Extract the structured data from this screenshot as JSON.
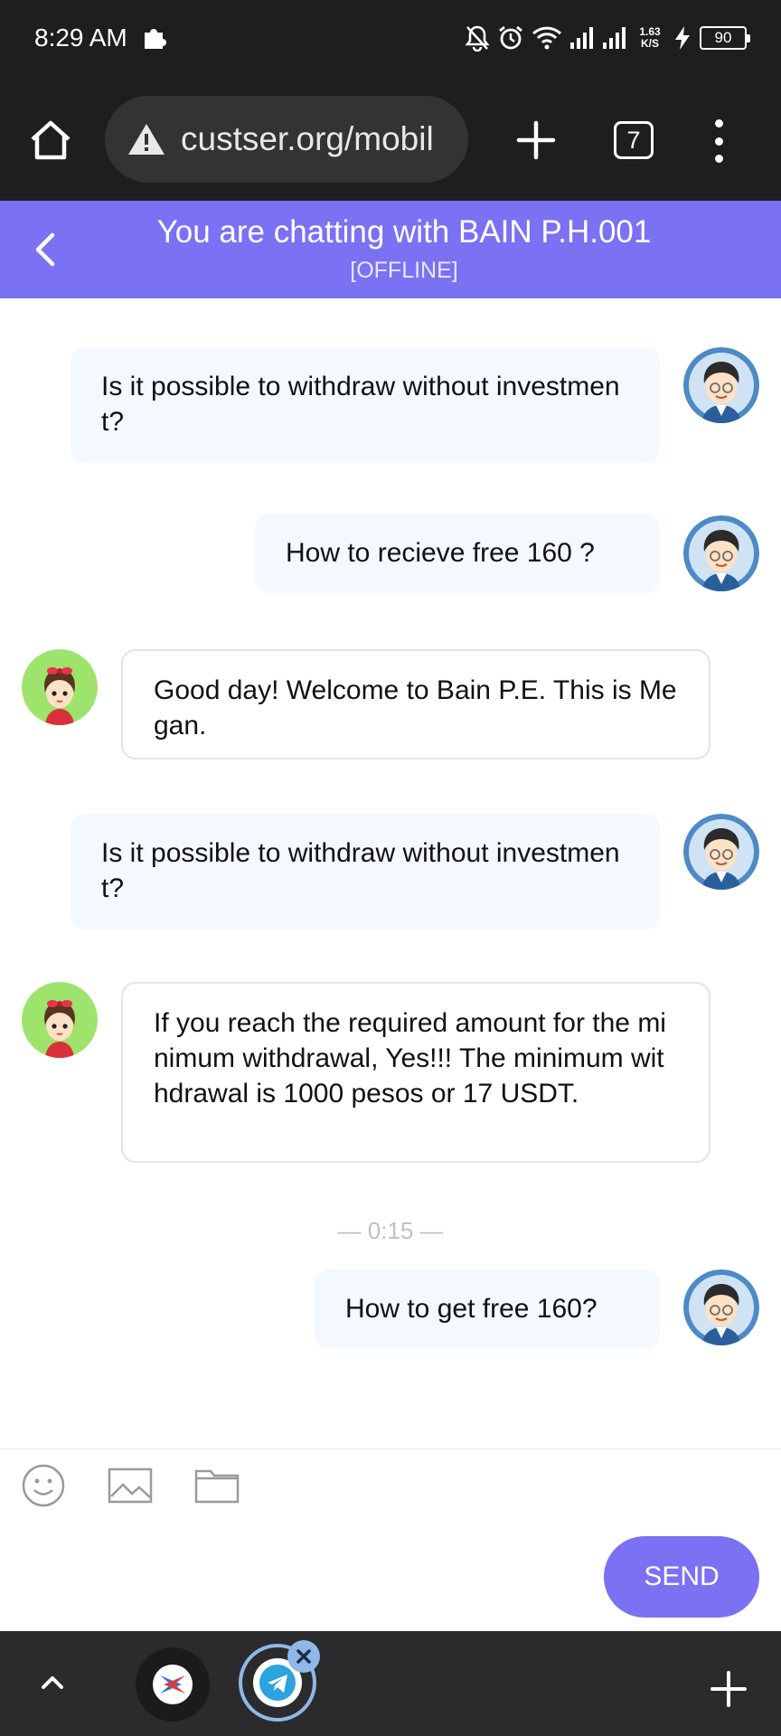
{
  "status_bar": {
    "time": "8:29 AM",
    "speed_value": "1.63",
    "speed_unit": "K/S",
    "battery": "90",
    "icons": [
      "puzzle-icon",
      "mute-icon",
      "alarm-icon",
      "wifi-icon",
      "signal-icon",
      "signal-icon",
      "charging-icon",
      "battery-icon"
    ]
  },
  "browser": {
    "url": "custser.org/mobil",
    "tab_count": "7",
    "icons": [
      "home-icon",
      "warning-icon",
      "plus-icon",
      "tabs-icon",
      "more-icon"
    ]
  },
  "chat": {
    "title": "You are chatting with BAIN P.H.001",
    "status": "[OFFLINE]",
    "accent_color": "#7b71f3",
    "messages": [
      {
        "side": "out",
        "text": "Is it possible to withdraw without investment?"
      },
      {
        "side": "out",
        "text": "How to recieve free 160 ?"
      },
      {
        "side": "in",
        "text": "Good day! Welcome to Bain P.E. This is Megan."
      },
      {
        "side": "out",
        "text": "Is it possible to withdraw without investment?"
      },
      {
        "side": "in",
        "text": "If you reach the required amount for the minimum withdrawal, Yes!!! The minimum withdrawal is 1000 pesos or 17 USDT."
      },
      {
        "side": "out",
        "text": "How to get free 160?"
      }
    ],
    "time_separator": "— 0:15 —"
  },
  "composer": {
    "send_label": "SEND",
    "tools": [
      "emoji-icon",
      "image-icon",
      "folder-icon"
    ]
  },
  "dock": {
    "icons": [
      "chevron-up-icon",
      "app-icon",
      "telegram-icon",
      "close-icon",
      "plus-icon"
    ]
  }
}
